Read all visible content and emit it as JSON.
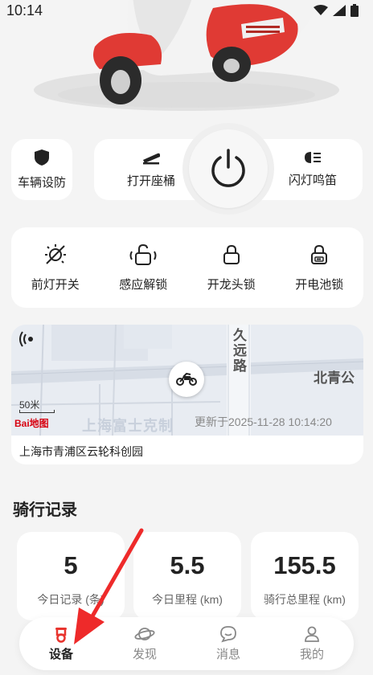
{
  "status_bar": {
    "time": "10:14"
  },
  "controls": {
    "defense_label": "车辆设防",
    "open_seat_label": "打开座桶",
    "flash_horn_label": "闪灯鸣笛"
  },
  "locks": [
    {
      "label": "前灯开关",
      "icon": "bulb-off-icon"
    },
    {
      "label": "感应解锁",
      "icon": "proximity-unlock-icon"
    },
    {
      "label": "开龙头锁",
      "icon": "lock-icon"
    },
    {
      "label": "开电池锁",
      "icon": "battery-lock-icon"
    }
  ],
  "map": {
    "road_jiuyuan": "久远路",
    "road_beiqing": "北青公",
    "watermark": "上海富士克制",
    "updated": "更新于2025-11-28 10:14:20",
    "scale": "50米",
    "map_logo": "Bai地图",
    "address": "上海市青浦区云轮科创园"
  },
  "riding": {
    "title": "骑行记录",
    "stats": [
      {
        "value": "5",
        "label": "今日记录 (条)"
      },
      {
        "value": "5.5",
        "label": "今日里程 (km)"
      },
      {
        "value": "155.5",
        "label": "骑行总里程 (km)"
      }
    ]
  },
  "tabs": [
    {
      "label": "设备",
      "active": true
    },
    {
      "label": "发现",
      "active": false
    },
    {
      "label": "消息",
      "active": false
    },
    {
      "label": "我的",
      "active": false
    }
  ],
  "colors": {
    "accent": "#e8342e",
    "map_bg": "#e8ecf2"
  }
}
